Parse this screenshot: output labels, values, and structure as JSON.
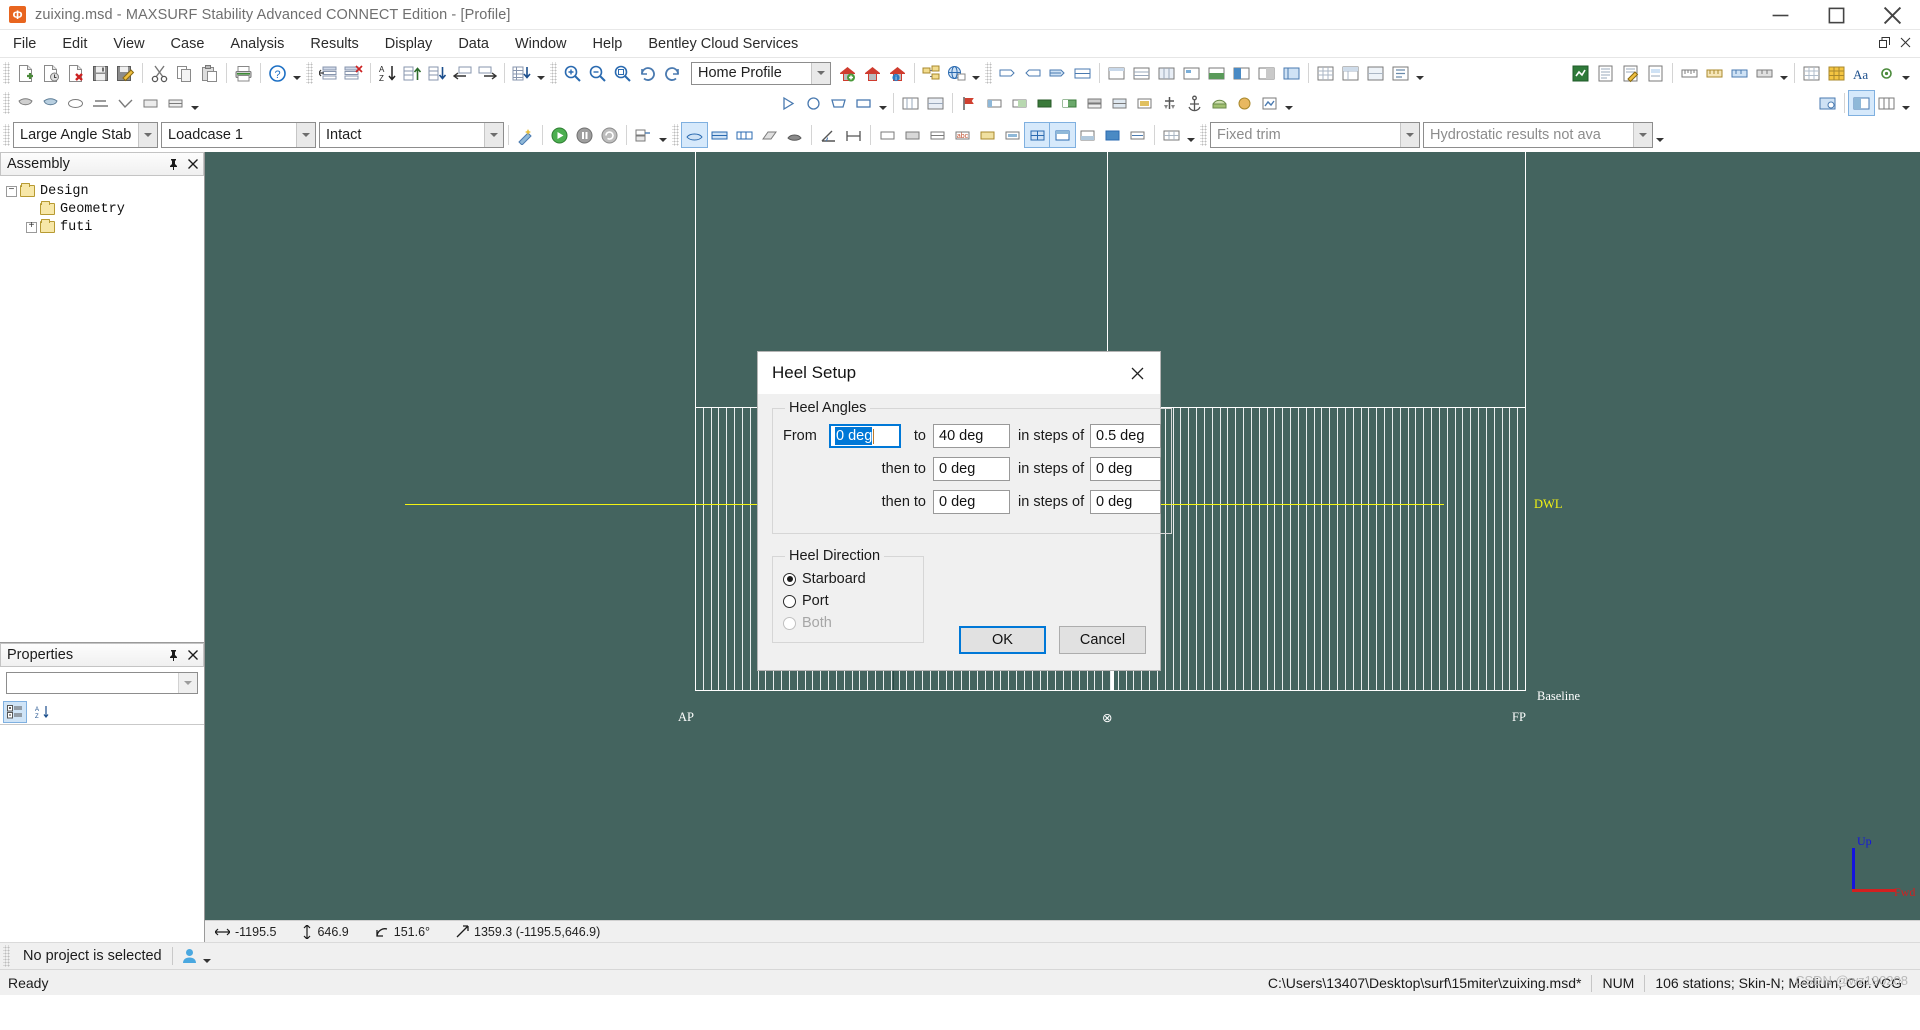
{
  "window": {
    "title": "zuixing.msd - MAXSURF Stability Advanced CONNECT Edition - [Profile]",
    "app_icon": "maxsurf-app-icon",
    "minimize_label": "Minimize",
    "maximize_label": "Maximize",
    "close_label": "Close",
    "mdi_restore_label": "Restore Window",
    "mdi_close_label": "Close Window"
  },
  "menubar": {
    "items": [
      {
        "label": "File"
      },
      {
        "label": "Edit"
      },
      {
        "label": "View"
      },
      {
        "label": "Case"
      },
      {
        "label": "Analysis"
      },
      {
        "label": "Results"
      },
      {
        "label": "Display"
      },
      {
        "label": "Data"
      },
      {
        "label": "Window"
      },
      {
        "label": "Help"
      },
      {
        "label": "Bentley Cloud Services"
      }
    ]
  },
  "toolbars": {
    "row1": {
      "home_profile_combo": "Home Profile",
      "buttons": [
        "new-document-icon",
        "open-document-icon",
        "delete-document-icon",
        "save-icon",
        "save-as-icon",
        "cut-icon",
        "copy-icon",
        "paste-icon",
        "print-icon",
        "help-icon",
        "insert-row-icon",
        "delete-row-icon",
        "sort-az-icon",
        "column-up-icon",
        "column-down-icon",
        "move-left-icon",
        "move-right-icon",
        "export-table-icon",
        "zoom-in-icon",
        "zoom-out-icon",
        "zoom-extents-icon",
        "undo-zoom-icon",
        "redo-zoom-icon",
        "home-add-icon",
        "home-icon",
        "home-info-icon",
        "view-tree-icon",
        "globe-info-icon",
        "tank-icon-1",
        "tank-icon-2",
        "tank-icon-3",
        "tank-icon-4",
        "tank-icon-5",
        "grid-icon-1",
        "grid-icon-2",
        "grid-icon-3",
        "grid-icon-4",
        "grid-icon-5",
        "grid-icon-6",
        "grid-icon-7",
        "grid-icon-8",
        "table-icon-1",
        "table-icon-2",
        "table-icon-3",
        "table-icon-4",
        "report-icon-1",
        "report-icon-2",
        "report-icon-3",
        "report-icon-4",
        "measure-icon-1",
        "measure-icon-2",
        "measure-icon-3",
        "measure-icon-4",
        "font-icon",
        "settings-icon"
      ]
    },
    "row2": {
      "buttons": [
        "hull-icon-1",
        "hull-icon-2",
        "hull-icon-3",
        "hull-icon-4",
        "hull-icon-5",
        "hull-icon-6",
        "hull-icon-7",
        "shape-triangle-icon",
        "shape-circle-icon",
        "shape-trapezoid-icon",
        "shape-box-icon",
        "compartment-icon-1",
        "compartment-icon-2",
        "flag-icon",
        "marker-icon-1",
        "marker-icon-2",
        "marker-icon-3",
        "color-fill-icon",
        "layer-icon-1",
        "layer-icon-2",
        "layer-icon-3",
        "weight-icon",
        "anchor-icon",
        "render-icon-1",
        "render-icon-2",
        "render-icon-3",
        "window-tile-icon",
        "window-split-icon",
        "window-arrange-icon"
      ]
    },
    "row3": {
      "analysis_type_combo": "Large Angle Stab",
      "loadcase_combo": "Loadcase 1",
      "condition_combo": "Intact",
      "trim_combo": "Fixed trim",
      "hydrostatic_combo": "Hydrostatic results not ava",
      "buttons": [
        "wand-icon",
        "run-analysis-icon",
        "pause-analysis-icon",
        "stop-analysis-icon",
        "batch-icon",
        "view-profile-icon",
        "view-plan-icon",
        "view-body-icon",
        "view-perspective-icon",
        "view-render-icon",
        "measure-angle-icon",
        "measure-length-icon",
        "display-icon-1",
        "display-icon-2",
        "display-icon-3",
        "display-icon-4",
        "display-icon-5",
        "display-icon-6",
        "display-icon-7",
        "display-icon-8",
        "display-icon-9",
        "display-icon-10",
        "display-icon-11",
        "grid-toggle-icon"
      ]
    }
  },
  "assembly_panel": {
    "title": "Assembly",
    "pin_icon": "pin-icon",
    "close_icon": "close-icon",
    "tree": [
      {
        "label": "Design",
        "expander": "-",
        "depth": 0
      },
      {
        "label": "Geometry",
        "expander": "",
        "depth": 1
      },
      {
        "label": "futi",
        "expander": "+",
        "depth": 1
      }
    ]
  },
  "properties_panel": {
    "title": "Properties",
    "pin_icon": "pin-icon",
    "close_icon": "close-icon",
    "selector_value": "",
    "categorized_icon": "categorized-view-icon",
    "alphabetical_icon": "alphabetical-sort-icon"
  },
  "viewport": {
    "background_color": "#44645f",
    "labels": {
      "ap": "AP",
      "midship": "⊗",
      "fp": "FP",
      "baseline": "Baseline",
      "dwl": "DWL"
    },
    "gizmo": {
      "up_label": "Up",
      "fwd_label": "Fwd",
      "up_color": "#1414e0",
      "fwd_color": "#d32020"
    },
    "dwl_color": "#f3f312",
    "station_count": 106
  },
  "coordinate_strip": {
    "x_icon": "horizontal-arrows-icon",
    "x_value": "-1195.5",
    "y_icon": "vertical-arrows-icon",
    "y_value": "646.9",
    "angle_icon": "angle-icon",
    "angle_value": "151.6°",
    "distance_icon": "diagonal-arrow-icon",
    "distance_value": "1359.3 (-1195.5,646.9)"
  },
  "project_bar": {
    "text": "No project is selected",
    "user_icon": "user-icon",
    "dropdown_icon": "chevron-down-icon"
  },
  "statusbar": {
    "ready_text": "Ready",
    "file_path": "C:\\Users\\13407\\Desktop\\surf\\15miter\\zuixing.msd*",
    "num_indicator": "NUM",
    "model_info": "106 stations; Skin-N; Medium; Cor.VCG",
    "watermark": "CSDN @wz190208"
  },
  "dialog": {
    "title": "Heel Setup",
    "close_icon": "close-icon",
    "heel_angles": {
      "legend": "Heel Angles",
      "rows": [
        {
          "prefix_label": "From",
          "from_value": "0 deg",
          "from_focused": true,
          "to_label": "to",
          "to_value": "40 deg",
          "steps_label": "in steps of",
          "steps_value": "0.5 deg"
        },
        {
          "prefix_label": "",
          "from_value": "",
          "from_focused": false,
          "to_label": "then to",
          "to_value": "0 deg",
          "steps_label": "in steps of",
          "steps_value": "0 deg"
        },
        {
          "prefix_label": "",
          "from_value": "",
          "from_focused": false,
          "to_label": "then to",
          "to_value": "0 deg",
          "steps_label": "in steps of",
          "steps_value": "0 deg"
        }
      ]
    },
    "heel_direction": {
      "legend": "Heel Direction",
      "options": [
        {
          "label": "Starboard",
          "selected": true,
          "disabled": false
        },
        {
          "label": "Port",
          "selected": false,
          "disabled": false
        },
        {
          "label": "Both",
          "selected": false,
          "disabled": true
        }
      ]
    },
    "ok_label": "OK",
    "cancel_label": "Cancel"
  }
}
